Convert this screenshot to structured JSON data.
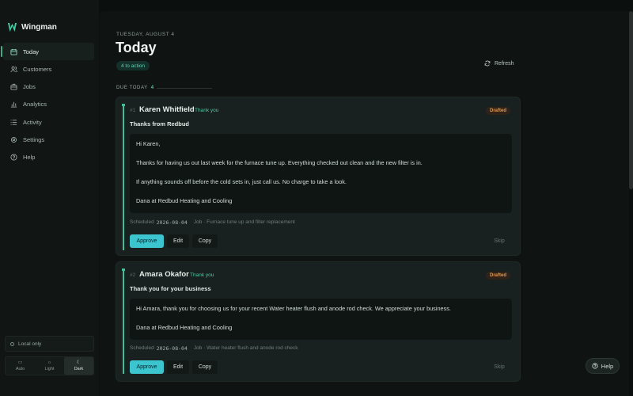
{
  "app": {
    "name": "Wingman"
  },
  "sidebar": {
    "items": [
      {
        "label": "Today",
        "icon": "calendar-icon",
        "active": true
      },
      {
        "label": "Customers",
        "icon": "users-icon"
      },
      {
        "label": "Jobs",
        "icon": "briefcase-icon"
      },
      {
        "label": "Analytics",
        "icon": "bar-chart-icon"
      },
      {
        "label": "Activity",
        "icon": "list-icon"
      },
      {
        "label": "Settings",
        "icon": "gear-icon"
      },
      {
        "label": "Help",
        "icon": "help-circle-icon"
      }
    ],
    "local_only": "Local only",
    "theme": {
      "options": [
        "Auto",
        "Light",
        "Dark"
      ],
      "selected": "Dark"
    }
  },
  "header": {
    "date": "TUESDAY, AUGUST 4",
    "title": "Today",
    "action_badge": "4  to action",
    "refresh_label": "Refresh"
  },
  "section": {
    "label": "DUE TODAY",
    "count": "4"
  },
  "cards": [
    {
      "number": "#1",
      "name": "Karen Whitfield",
      "tag": "Thank you",
      "status": "Drafted",
      "subject": "Thanks from Redbud",
      "body": [
        "Hi Karen,",
        "Thanks for having us out last week for the furnace tune up. Everything checked out clean and the new filter is in.",
        "If anything sounds off before the cold sets in, just call us. No charge to take a look.",
        "Dana at Redbud Heating and Cooling"
      ],
      "scheduled_label": "Scheduled",
      "scheduled_date": "2026-08-04",
      "job": "Job · Furnace tune up and filter replacement",
      "approve": "Approve",
      "edit": "Edit",
      "copy": "Copy",
      "skip": "Skip"
    },
    {
      "number": "#2",
      "name": "Amara Okafor",
      "tag": "Thank you",
      "status": "Drafted",
      "subject": "Thank you for your business",
      "body": [
        "Hi Amara, thank you for choosing us for your recent Water heater flush and anode rod check. We appreciate your business.",
        "Dana at Redbud Heating and Cooling"
      ],
      "scheduled_label": "Scheduled",
      "scheduled_date": "2026-08-04",
      "job": "Job · Water heater flush and anode rod check",
      "approve": "Approve",
      "edit": "Edit",
      "copy": "Copy",
      "skip": "Skip"
    }
  ],
  "help_button": "Help",
  "colors": {
    "accent": "#3bbf96",
    "approve": "#3cc4cf",
    "drafted": "#e39a52"
  }
}
